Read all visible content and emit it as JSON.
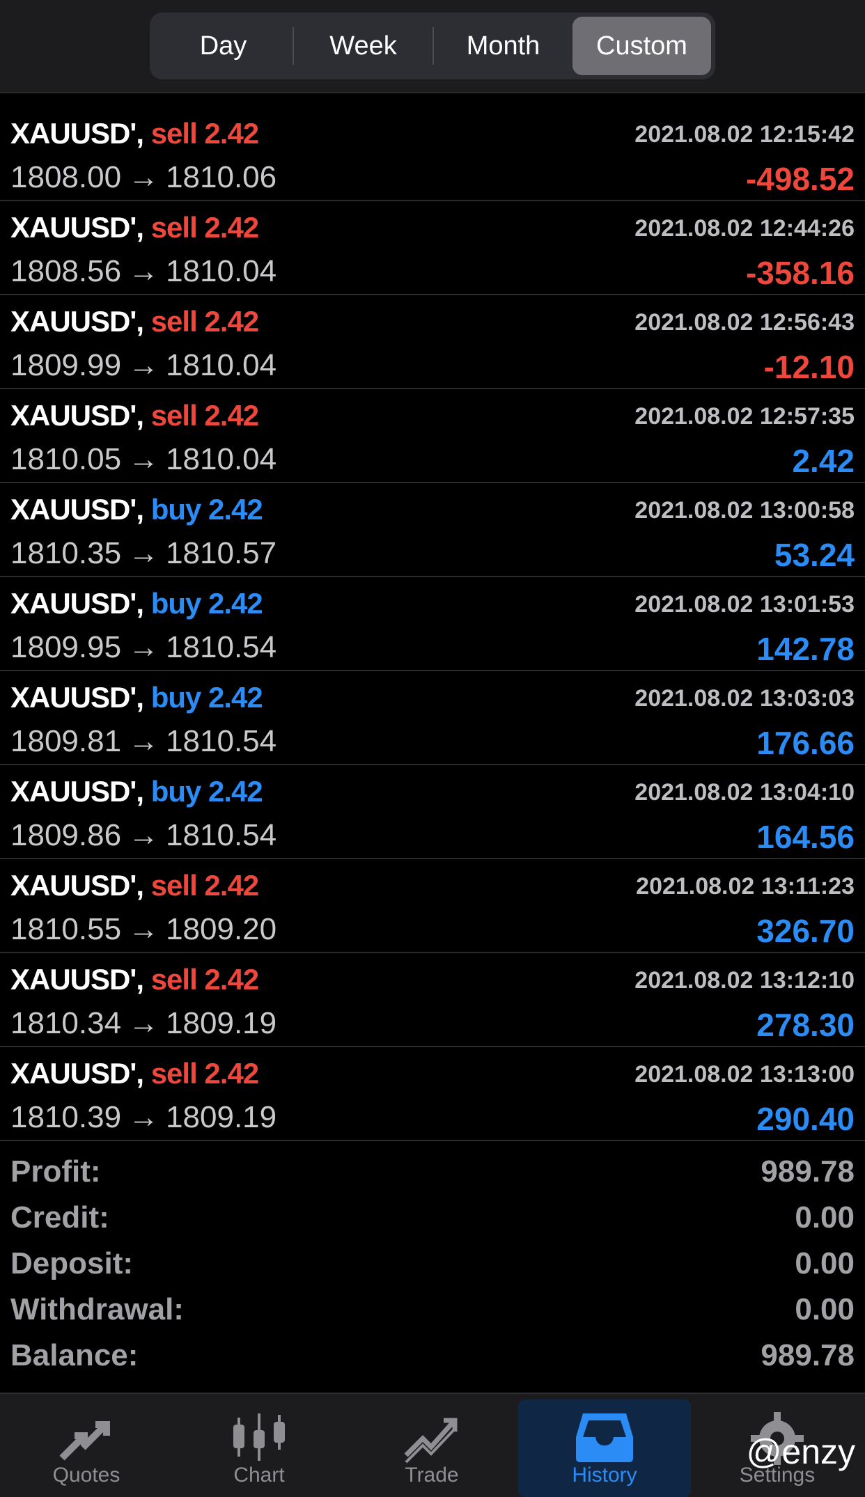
{
  "header": {
    "segments": [
      "Day",
      "Week",
      "Month",
      "Custom"
    ],
    "active": "Custom"
  },
  "trades": [
    {
      "symbol": "XAUUSD'",
      "side": "sell",
      "volume": "2.42",
      "time": "2021.08.02 12:15:42",
      "open": "1808.00",
      "close": "1810.06",
      "profit": "-498.52"
    },
    {
      "symbol": "XAUUSD'",
      "side": "sell",
      "volume": "2.42",
      "time": "2021.08.02 12:44:26",
      "open": "1808.56",
      "close": "1810.04",
      "profit": "-358.16"
    },
    {
      "symbol": "XAUUSD'",
      "side": "sell",
      "volume": "2.42",
      "time": "2021.08.02 12:56:43",
      "open": "1809.99",
      "close": "1810.04",
      "profit": "-12.10"
    },
    {
      "symbol": "XAUUSD'",
      "side": "sell",
      "volume": "2.42",
      "time": "2021.08.02 12:57:35",
      "open": "1810.05",
      "close": "1810.04",
      "profit": "2.42"
    },
    {
      "symbol": "XAUUSD'",
      "side": "buy",
      "volume": "2.42",
      "time": "2021.08.02 13:00:58",
      "open": "1810.35",
      "close": "1810.57",
      "profit": "53.24"
    },
    {
      "symbol": "XAUUSD'",
      "side": "buy",
      "volume": "2.42",
      "time": "2021.08.02 13:01:53",
      "open": "1809.95",
      "close": "1810.54",
      "profit": "142.78"
    },
    {
      "symbol": "XAUUSD'",
      "side": "buy",
      "volume": "2.42",
      "time": "2021.08.02 13:03:03",
      "open": "1809.81",
      "close": "1810.54",
      "profit": "176.66"
    },
    {
      "symbol": "XAUUSD'",
      "side": "buy",
      "volume": "2.42",
      "time": "2021.08.02 13:04:10",
      "open": "1809.86",
      "close": "1810.54",
      "profit": "164.56"
    },
    {
      "symbol": "XAUUSD'",
      "side": "sell",
      "volume": "2.42",
      "time": "2021.08.02 13:11:23",
      "open": "1810.55",
      "close": "1809.20",
      "profit": "326.70"
    },
    {
      "symbol": "XAUUSD'",
      "side": "sell",
      "volume": "2.42",
      "time": "2021.08.02 13:12:10",
      "open": "1810.34",
      "close": "1809.19",
      "profit": "278.30"
    },
    {
      "symbol": "XAUUSD'",
      "side": "sell",
      "volume": "2.42",
      "time": "2021.08.02 13:13:00",
      "open": "1810.39",
      "close": "1809.19",
      "profit": "290.40"
    }
  ],
  "summary": {
    "profit_label": "Profit:",
    "profit": "989.78",
    "credit_label": "Credit:",
    "credit": "0.00",
    "deposit_label": "Deposit:",
    "deposit": "0.00",
    "withdrawal_label": "Withdrawal:",
    "withdrawal": "0.00",
    "balance_label": "Balance:",
    "balance": "989.78"
  },
  "tabbar": {
    "tabs": [
      {
        "label": "Quotes",
        "icon": "quotes-arrows-icon"
      },
      {
        "label": "Chart",
        "icon": "candlestick-chart-icon"
      },
      {
        "label": "Trade",
        "icon": "trade-trend-icon"
      },
      {
        "label": "History",
        "icon": "inbox-tray-icon"
      },
      {
        "label": "Settings",
        "icon": "gear-icon"
      }
    ],
    "active": "History"
  },
  "watermark": "@enzy",
  "colors": {
    "sell": "#f0473d",
    "buy": "#2b8cf6",
    "background": "#000000",
    "bar": "#1c1c1e"
  }
}
